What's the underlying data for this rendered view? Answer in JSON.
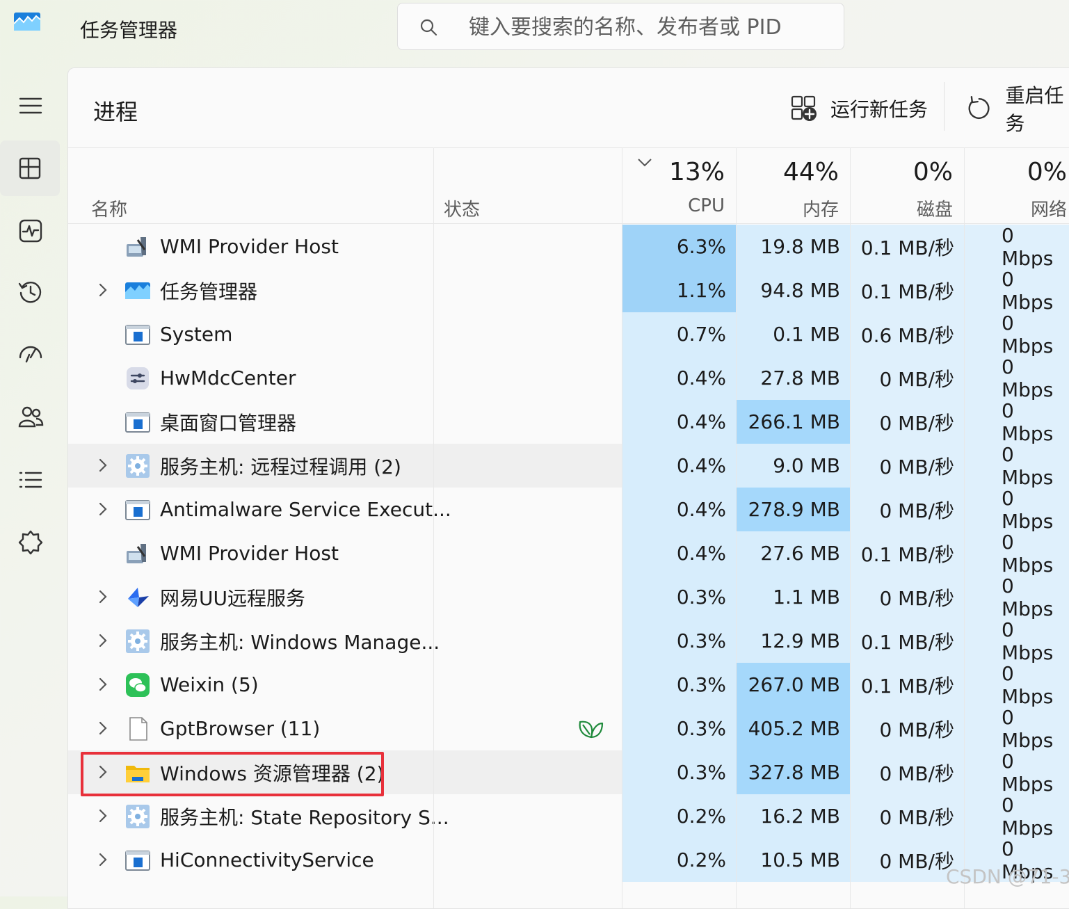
{
  "app": {
    "title": "任务管理器"
  },
  "search": {
    "placeholder": "键入要搜索的名称、发布者或 PID"
  },
  "page": {
    "title": "进程"
  },
  "toolbar": {
    "run_new_task": "运行新任务",
    "restart_task": "重启任务"
  },
  "columns": {
    "name": "名称",
    "status": "状态",
    "cpu": {
      "pct": "13%",
      "label": "CPU"
    },
    "memory": {
      "pct": "44%",
      "label": "内存"
    },
    "disk": {
      "pct": "0%",
      "label": "磁盘"
    },
    "network": {
      "pct": "0%",
      "label": "网络"
    }
  },
  "colors": {
    "cpu_hot": "#9fd3f8",
    "cpu_light": "#d7edfc",
    "mem_hot": "#a5d8fb",
    "mem_light": "#d7edfc",
    "disk_light": "#dff0fc",
    "net_light": "#dff0fc",
    "highlight_border": "#e8303a",
    "accent": "#0a63c9"
  },
  "processes": [
    {
      "name": "WMI Provider Host",
      "icon": "wmi-icon",
      "expandable": false,
      "cpu": "6.3%",
      "memory": "19.8 MB",
      "disk": "0.1 MB/秒",
      "network": "0 Mbps",
      "cpu_hot": true,
      "mem_hot": false,
      "highlighted": false
    },
    {
      "name": "任务管理器",
      "icon": "task-manager-icon",
      "expandable": true,
      "cpu": "1.1%",
      "memory": "94.8 MB",
      "disk": "0.1 MB/秒",
      "network": "0 Mbps",
      "cpu_hot": true,
      "mem_hot": false,
      "highlighted": false
    },
    {
      "name": "System",
      "icon": "system-window-icon",
      "expandable": false,
      "cpu": "0.7%",
      "memory": "0.1 MB",
      "disk": "0.6 MB/秒",
      "network": "0 Mbps",
      "cpu_hot": false,
      "mem_hot": false,
      "highlighted": false
    },
    {
      "name": "HwMdcCenter",
      "icon": "hw-settings-icon",
      "expandable": false,
      "cpu": "0.4%",
      "memory": "27.8 MB",
      "disk": "0 MB/秒",
      "network": "0 Mbps",
      "cpu_hot": false,
      "mem_hot": false,
      "highlighted": false
    },
    {
      "name": "桌面窗口管理器",
      "icon": "system-window-icon",
      "expandable": false,
      "cpu": "0.4%",
      "memory": "266.1 MB",
      "disk": "0 MB/秒",
      "network": "0 Mbps",
      "cpu_hot": false,
      "mem_hot": true,
      "highlighted": false
    },
    {
      "name": "服务主机: 远程过程调用 (2)",
      "icon": "service-gear-icon",
      "expandable": true,
      "cpu": "0.4%",
      "memory": "9.0 MB",
      "disk": "0 MB/秒",
      "network": "0 Mbps",
      "cpu_hot": false,
      "mem_hot": false,
      "highlighted": true
    },
    {
      "name": "Antimalware Service Execut...",
      "icon": "system-window-icon",
      "expandable": true,
      "cpu": "0.4%",
      "memory": "278.9 MB",
      "disk": "0 MB/秒",
      "network": "0 Mbps",
      "cpu_hot": false,
      "mem_hot": true,
      "highlighted": false
    },
    {
      "name": "WMI Provider Host",
      "icon": "wmi-icon",
      "expandable": false,
      "cpu": "0.4%",
      "memory": "27.6 MB",
      "disk": "0.1 MB/秒",
      "network": "0 Mbps",
      "cpu_hot": false,
      "mem_hot": false,
      "highlighted": false
    },
    {
      "name": "网易UU远程服务",
      "icon": "uu-remote-icon",
      "expandable": true,
      "cpu": "0.3%",
      "memory": "1.1 MB",
      "disk": "0 MB/秒",
      "network": "0 Mbps",
      "cpu_hot": false,
      "mem_hot": false,
      "highlighted": false
    },
    {
      "name": "服务主机: Windows Manage...",
      "icon": "service-gear-icon",
      "expandable": true,
      "cpu": "0.3%",
      "memory": "12.9 MB",
      "disk": "0.1 MB/秒",
      "network": "0 Mbps",
      "cpu_hot": false,
      "mem_hot": false,
      "highlighted": false
    },
    {
      "name": "Weixin (5)",
      "icon": "wechat-icon",
      "expandable": true,
      "cpu": "0.3%",
      "memory": "267.0 MB",
      "disk": "0.1 MB/秒",
      "network": "0 Mbps",
      "cpu_hot": false,
      "mem_hot": true,
      "highlighted": false
    },
    {
      "name": "GptBrowser (11)",
      "icon": "blank-file-icon",
      "expandable": true,
      "cpu": "0.3%",
      "memory": "405.2 MB",
      "disk": "0 MB/秒",
      "network": "0 Mbps",
      "cpu_hot": false,
      "mem_hot": true,
      "highlighted": false,
      "status_icon": "efficiency-leaf-icon"
    },
    {
      "name": "Windows 资源管理器 (2)",
      "icon": "folder-icon",
      "expandable": true,
      "cpu": "0.3%",
      "memory": "327.8 MB",
      "disk": "0 MB/秒",
      "network": "0 Mbps",
      "cpu_hot": false,
      "mem_hot": true,
      "highlighted": true
    },
    {
      "name": "服务主机: State Repository S...",
      "icon": "service-gear-icon",
      "expandable": true,
      "cpu": "0.2%",
      "memory": "16.2 MB",
      "disk": "0 MB/秒",
      "network": "0 Mbps",
      "cpu_hot": false,
      "mem_hot": false,
      "highlighted": false
    },
    {
      "name": "HiConnectivityService",
      "icon": "system-window-icon",
      "expandable": true,
      "cpu": "0.2%",
      "memory": "10.5 MB",
      "disk": "0 MB/秒",
      "network": "0 Mbps",
      "cpu_hot": false,
      "mem_hot": false,
      "highlighted": false
    }
  ],
  "nav": [
    {
      "name": "hamburger-menu-icon"
    },
    {
      "name": "processes-icon",
      "active": true
    },
    {
      "name": "performance-icon"
    },
    {
      "name": "app-history-icon"
    },
    {
      "name": "startup-apps-icon"
    },
    {
      "name": "users-icon"
    },
    {
      "name": "details-icon"
    },
    {
      "name": "services-icon"
    }
  ],
  "watermark": "CSDN @71-3"
}
